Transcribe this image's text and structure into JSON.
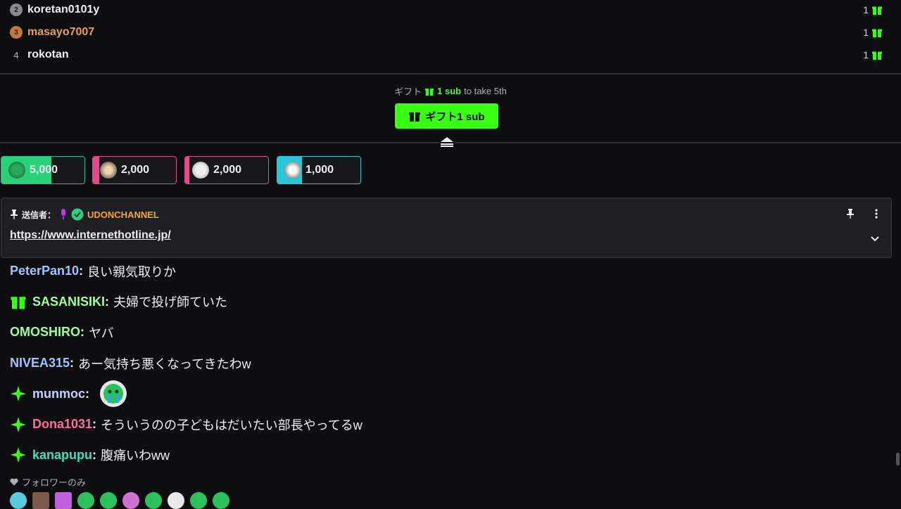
{
  "leaderboard": {
    "rows": [
      {
        "rank": "2",
        "name": "koretan0101y",
        "count": "1"
      },
      {
        "rank": "3",
        "name": "masayo7007",
        "count": "1"
      },
      {
        "rank": "4",
        "name": "rokotan",
        "count": "1"
      }
    ]
  },
  "gift": {
    "prefix": "ギフト",
    "amount": "1 sub",
    "suffix": "to take 5th",
    "button_label": "ギフト1 sub"
  },
  "badge_chips": [
    {
      "value": "5,000",
      "border": "#28c08c",
      "fill": "#2ad07a",
      "fill_fraction": 0.6
    },
    {
      "value": "2,000",
      "border": "#e04c8a",
      "fill": "#e04c8a",
      "fill_fraction": 0.08
    },
    {
      "value": "2,000",
      "border": "#e04c8a",
      "fill": "#e04c8a",
      "fill_fraction": 0.05
    },
    {
      "value": "1,000",
      "border": "#29c7d8",
      "fill": "#29c7d8",
      "fill_fraction": 0.3
    }
  ],
  "pinned": {
    "sender_label": "送信者：",
    "sender_name": "UDONCHANNEL",
    "link": "https://www.internethotline.jp/"
  },
  "chat": [
    {
      "user": "PeterPan10",
      "color": "#9ec3ff",
      "badge": "",
      "text": "良い親気取りか"
    },
    {
      "user": "SASANISIKI",
      "color": "#9dff9d",
      "badge": "gift",
      "text": "夫婦で投げ師ていた"
    },
    {
      "user": "OMOSHIRO",
      "color": "#9dff9d",
      "badge": "",
      "text": "ヤバ"
    },
    {
      "user": "NIVEA315",
      "color": "#9ec3ff",
      "badge": "",
      "text": "あー気持ち悪くなってきたわw"
    },
    {
      "user": "munmoc",
      "color": "#c9ccff",
      "badge": "sparkle",
      "text": ""
    },
    {
      "user": "Dona1031",
      "color": "#ff6b9a",
      "badge": "sparkle",
      "text": "そういうのの子どもはだいたい部長やってるw"
    },
    {
      "user": "kanapupu",
      "color": "#3ee0c0",
      "badge": "sparkle",
      "text": "腹痛いわww"
    }
  ],
  "followers_only": "フォロワーのみ",
  "colors": {
    "accent": "#39ff14",
    "background": "#0e0e10"
  }
}
